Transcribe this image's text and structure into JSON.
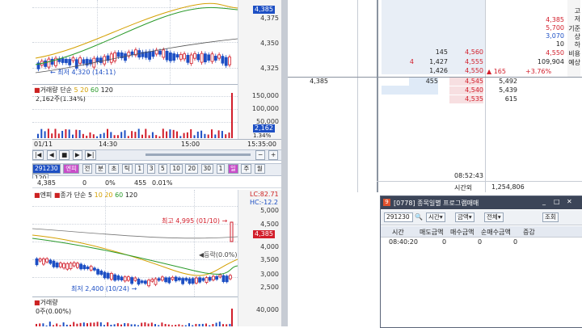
{
  "top_chart": {
    "price_ticks": [
      "4,385",
      "4,375",
      "4,350",
      "4,325"
    ],
    "last_price_tag": "4,385",
    "low_label": "최저 4,320 (14:11)",
    "volume_header": [
      "거래량",
      "단순",
      "5",
      "20",
      "60",
      "120"
    ],
    "volume_value": "2,162주(1.34%)",
    "volume_ticks": [
      "150,000",
      "100,000",
      "50,000"
    ],
    "volume_tag": "2,162",
    "volume_pct": "1.34%",
    "time_labels": [
      "01/11",
      "14:30",
      "15:00",
      "15:35:00"
    ]
  },
  "bottom_chart": {
    "toolbar_code": "291230",
    "toolbar_buttons": [
      "엔피",
      "전",
      "분",
      "초",
      "틱",
      "1",
      "3",
      "5",
      "10",
      "20",
      "30",
      "1",
      "일",
      "주",
      "월"
    ],
    "toolbar_counter": "120",
    "info_row": [
      "4,385",
      "0",
      "0%",
      "455",
      "0.01%"
    ],
    "legend": [
      "엔피",
      "종가",
      "단순",
      "5",
      "10",
      "20",
      "60",
      "120"
    ],
    "lc": "LC:82.71",
    "hc": "HC:-12.2",
    "high_label": "최고 4,995 (01/10)",
    "low_label": "최저 2,400 (10/24)",
    "mid_label": "등락(0.0%)",
    "price_ticks": [
      "5,000",
      "4,500",
      "4,000",
      "3,500",
      "3,000",
      "2,500"
    ],
    "last_price_tag": "4,385",
    "volume_header": "거래량",
    "volume_value": "0주(0.00%)",
    "volume_tick": "40,000"
  },
  "order_book": {
    "right_labels": [
      "고",
      "저",
      "기준",
      "상",
      "하",
      "비용",
      "예상",
      "수량",
      "권"
    ],
    "right_values": [
      "4,385",
      "5,700",
      "3,070",
      "10",
      "4,550",
      "109,904"
    ],
    "change": "165",
    "change_pct": "+3.76%",
    "ask_rows": [
      {
        "side": "",
        "qty": "145",
        "price": "4,560"
      },
      {
        "side": "4",
        "qty": "1,427",
        "price": "4,555"
      },
      {
        "side": "",
        "qty": "1,426",
        "price": "4,550"
      }
    ],
    "current_row": {
      "left": "4,385",
      "qty": "455",
      "price": "4,545",
      "bid_qty": "5,492"
    },
    "bid_rows": [
      {
        "price": "4,540",
        "qty": "5,439"
      },
      {
        "price": "4,535",
        "qty": "615"
      }
    ],
    "time": "08:52:43",
    "footer_label": "시간외",
    "footer_value": "1,254,806"
  },
  "program_window": {
    "title": "[0778] 종목일별 프로그램매매",
    "code": "291230",
    "sel1": "시간",
    "sel2": "금액",
    "sel3": "전체",
    "query_button": "조회",
    "headers": [
      "시간",
      "매도금액",
      "매수금액",
      "순매수금액",
      "증감"
    ],
    "rows": [
      {
        "time": "08:40:20",
        "sell": "0",
        "buy": "0",
        "net": "0",
        "chg": ""
      }
    ]
  }
}
